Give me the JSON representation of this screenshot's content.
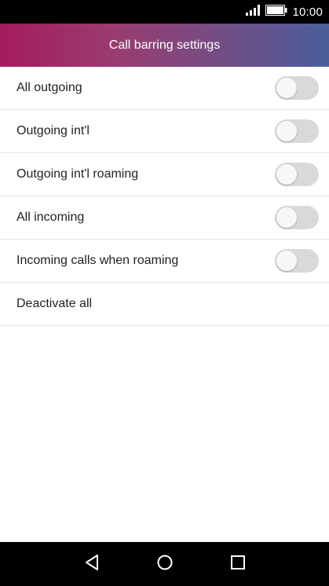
{
  "status_bar": {
    "time": "10:00",
    "icons": [
      "signal-icon",
      "battery-icon"
    ]
  },
  "header": {
    "title": "Call barring settings"
  },
  "settings": {
    "items": [
      {
        "label": "All outgoing",
        "toggle": false
      },
      {
        "label": "Outgoing int'l",
        "toggle": false
      },
      {
        "label": "Outgoing int'l roaming",
        "toggle": false
      },
      {
        "label": "All incoming",
        "toggle": false
      },
      {
        "label": "Incoming calls when roaming",
        "toggle": false
      },
      {
        "label": "Deactivate all"
      }
    ]
  },
  "nav_bar": {
    "icons": [
      "back-icon",
      "home-icon",
      "recents-icon"
    ]
  },
  "colors": {
    "header_gradient_start": "#a41c5d",
    "header_gradient_end": "#4b5e9c",
    "toggle_off": "#d9d9d9"
  }
}
